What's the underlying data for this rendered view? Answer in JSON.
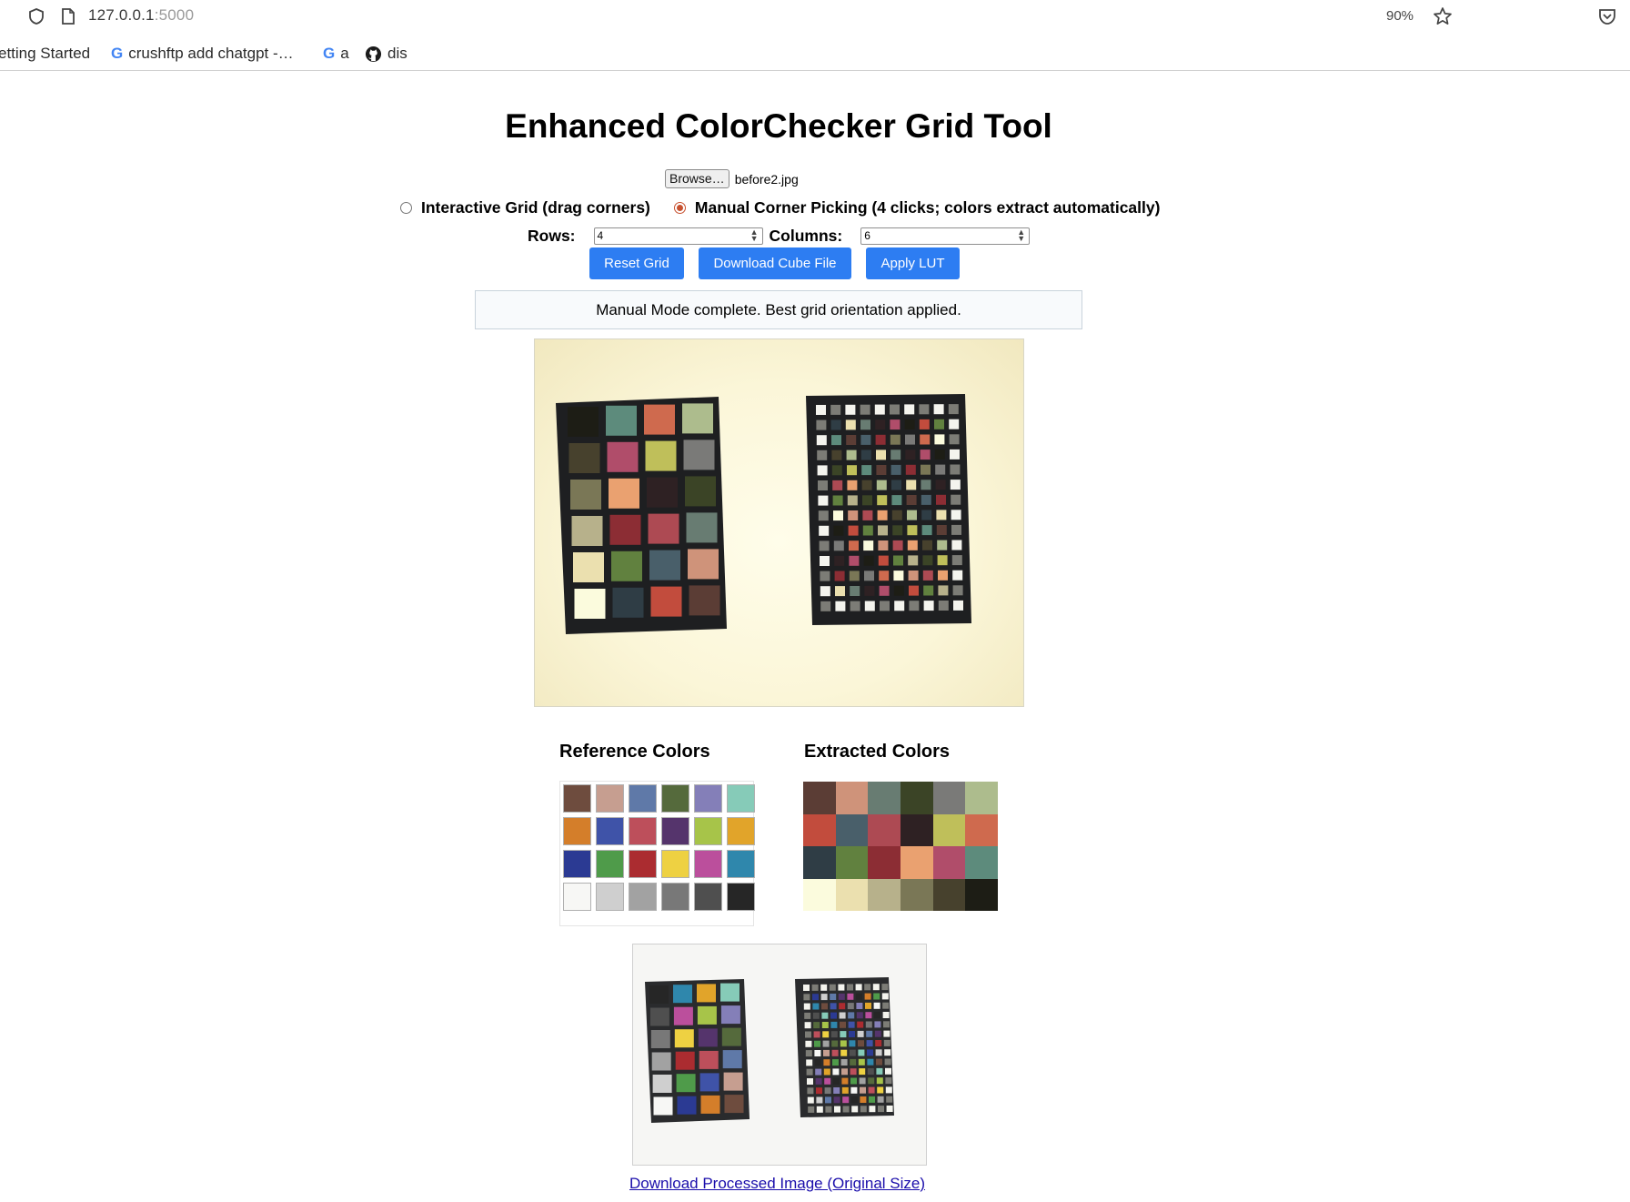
{
  "browser": {
    "url_host": "127.0.0.1",
    "url_port": ":5000",
    "zoom": "90%",
    "bookmarks": [
      "etting Started",
      "crushftp add chatgpt -…",
      "a",
      "dis"
    ]
  },
  "app": {
    "title": "Enhanced ColorChecker Grid Tool",
    "file": {
      "browse_label": "Browse…",
      "file_name": "before2.jpg"
    },
    "modes": [
      {
        "label": "Interactive Grid (drag corners)",
        "selected": false
      },
      {
        "label": "Manual Corner Picking (4 clicks; colors extract automatically)",
        "selected": true
      }
    ],
    "rows_label": "Rows:",
    "rows_value": "4",
    "columns_label": "Columns:",
    "columns_value": "6",
    "buttons": {
      "reset": "Reset Grid",
      "cube": "Download Cube File",
      "lut": "Apply LUT"
    },
    "status": "Manual Mode complete. Best grid orientation applied.",
    "reference_title": "Reference Colors",
    "extracted_title": "Extracted Colors",
    "reference_colors": [
      "#6e4c3e",
      "#c69e90",
      "#5f79a8",
      "#556a3c",
      "#847fb8",
      "#86cbb8",
      "#d47e2a",
      "#3f53a8",
      "#bd4f5b",
      "#55346c",
      "#a7c449",
      "#e1a42a",
      "#2b3a93",
      "#4f9b4a",
      "#ab2c30",
      "#eed142",
      "#bb4f9c",
      "#2f87ac",
      "#f7f7f5",
      "#cfcfcf",
      "#a2a2a2",
      "#787878",
      "#4f4f4f",
      "#262626"
    ],
    "extracted_colors": [
      "#5b3d35",
      "#cf937a",
      "#687c72",
      "#3b4426",
      "#7a7a78",
      "#adbc8d",
      "#c24c3d",
      "#495f6a",
      "#ad4a53",
      "#2e2123",
      "#bfbf5a",
      "#cf6a4e",
      "#2f3d45",
      "#61813f",
      "#8c2d34",
      "#eaa170",
      "#b04d6a",
      "#5d8b7c",
      "#fbfbdd",
      "#ebe0af",
      "#b7b18b",
      "#7a7756",
      "#47412d",
      "#1d1d15"
    ],
    "download_link": "Download Processed Image (Original Size)"
  }
}
